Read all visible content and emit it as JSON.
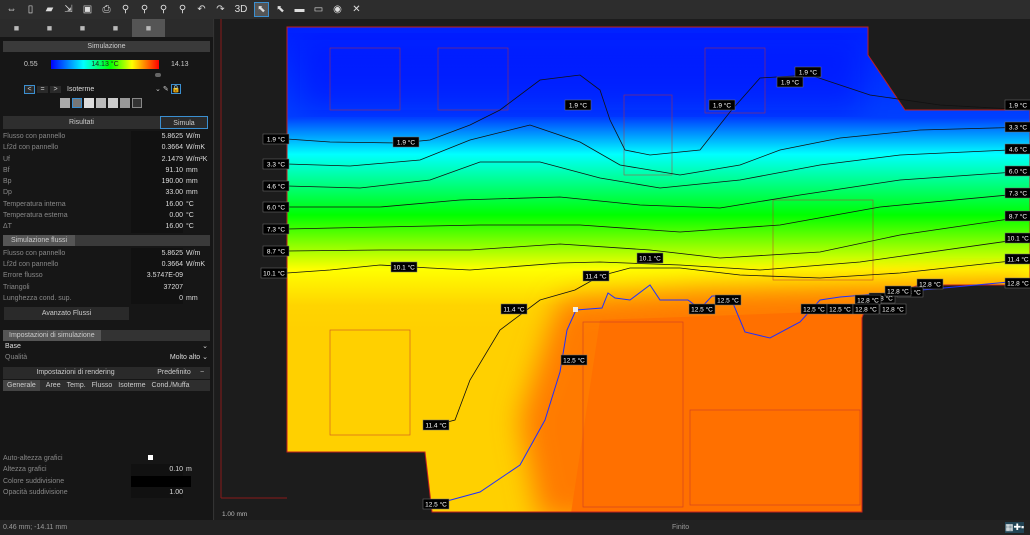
{
  "toolbar": {
    "icons": [
      "fit-view-icon",
      "new-file-icon",
      "open-folder-icon",
      "import-icon",
      "save-icon",
      "print-icon",
      "zoom-in-icon",
      "zoom-out-icon",
      "zoom-window-icon",
      "zoom-all-icon",
      "undo-icon",
      "redo-icon"
    ],
    "three_d": "3D",
    "right_icons": [
      "select-icon",
      "select-node-icon",
      "measure-icon",
      "comment-icon",
      "eye-icon",
      "grid-off-icon"
    ]
  },
  "panel": {
    "tabs": [
      "layers-icon",
      "crop-icon",
      "copy-icon",
      "shape-icon",
      "simulation-icon"
    ],
    "section_title": "Simulazione",
    "scale": {
      "min": "0.55",
      "max": "14.13",
      "center_label": "14.13 °C"
    },
    "mode": {
      "lt": "<",
      "eq": "=",
      "gt": ">",
      "select": "Isoterme"
    },
    "results_tab": "Risultati",
    "simulate_button": "Simula",
    "results": [
      {
        "k": "Flusso con pannello",
        "v": "5.8625",
        "u": "W/m"
      },
      {
        "k": "Lf2d con pannello",
        "v": "0.3664",
        "u": "W/mK"
      },
      {
        "k": "Uf",
        "v": "2.1479",
        "u": "W/m²K"
      },
      {
        "k": "Bf",
        "v": "91.10",
        "u": "mm"
      },
      {
        "k": "Bp",
        "v": "190.00",
        "u": "mm"
      },
      {
        "k": "Dp",
        "v": "33.00",
        "u": "mm"
      },
      {
        "k": "Temperatura interna",
        "v": "16.00",
        "u": "°C"
      },
      {
        "k": "Temperatura esterna",
        "v": "0.00",
        "u": "°C"
      },
      {
        "k": "ΔT",
        "v": "16.00",
        "u": "°C"
      }
    ],
    "flow_title": "Simulazione flussi",
    "flow": [
      {
        "k": "Flusso con pannello",
        "v": "5.8625",
        "u": "W/m"
      },
      {
        "k": "Lf2d con pannello",
        "v": "0.3664",
        "u": "W/mK"
      },
      {
        "k": "Errore flusso",
        "v": "3.5747E-09",
        "u": ""
      },
      {
        "k": "Triangoli",
        "v": "37207",
        "u": ""
      },
      {
        "k": "Lunghezza cond. sup.",
        "v": "0",
        "u": "mm"
      }
    ],
    "advanced_button": "Avanzato Flussi",
    "sim_settings_title": "Impostazioni di simulazione",
    "base": "Base",
    "quality_label": "Qualità",
    "quality_value": "Molto alto",
    "render_title": "Impostazioni di rendering",
    "render_default": "Predefinito",
    "render_tabs": [
      "Generale",
      "Aree",
      "Temp.",
      "Flusso",
      "Isoterme",
      "Cond./Muffa"
    ],
    "render_rows": [
      {
        "k": "Auto-altezza grafici",
        "v": "",
        "u": ""
      },
      {
        "k": "Altezza grafici",
        "v": "0.10",
        "u": "m"
      },
      {
        "k": "Colore suddivisione",
        "v": "",
        "u": ""
      },
      {
        "k": "Opacità suddivisione",
        "v": "1.00",
        "u": ""
      }
    ]
  },
  "canvas": {
    "scale_label": "1.00 mm",
    "isotherm_labels": [
      "1.9 °C",
      "3.3 °C",
      "4.6 °C",
      "6.0 °C",
      "7.3 °C",
      "8.7 °C",
      "10.1 °C",
      "11.4 °C",
      "12.5 °C",
      "12.8 °C"
    ]
  },
  "status": {
    "coords": "0.46 mm; -14.11 mm",
    "state": "Finito"
  }
}
